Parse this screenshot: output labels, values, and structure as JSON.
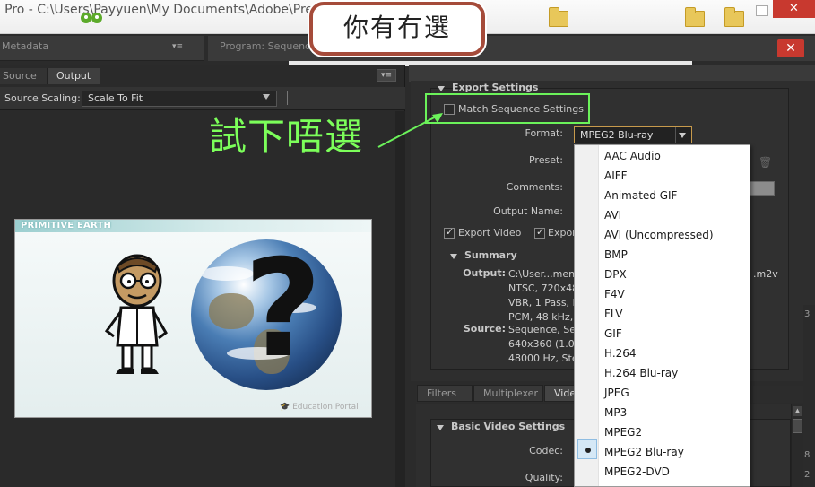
{
  "window": {
    "title": "e Pro - C:\\Users\\Payyuen\\My Documents\\Adobe\\Pre",
    "close_label": "✕"
  },
  "left_panel": {
    "metadata_tab": "Metadata",
    "tabs": [
      {
        "label": "Source"
      },
      {
        "label": "Output"
      }
    ],
    "menu_glyph": "▾≡",
    "source_scaling_label": "Source Scaling:",
    "source_scaling_value": "Scale To Fit"
  },
  "program_panel": {
    "title": "Program: Sequence",
    "close_label": "✕"
  },
  "video": {
    "banner_text": "PRIMITIVE EARTH",
    "question_mark": "?",
    "watermark": "Education Portal",
    "watermark_icon": "mortarboard-icon"
  },
  "export_settings": {
    "header": "Export Settings",
    "match_sequence_label": "Match Sequence Settings",
    "format_label": "Format:",
    "format_value": "MPEG2 Blu-ray",
    "preset_label": "Preset:",
    "comments_label": "Comments:",
    "output_name_label": "Output Name:",
    "export_video_label": "Export Video",
    "export_audio_label": "Expor",
    "summary_header": "Summary",
    "summary_output_label": "Output:",
    "summary_output_lines": [
      "C:\\User...ment",
      "NTSC, 720x480",
      "VBR, 1 Pass, M",
      "PCM, 48 kHz, 1"
    ],
    "summary_output_suffix": ".m2v",
    "summary_source_label": "Source:",
    "summary_source_lines": [
      "Sequence, Seq",
      "640x360 (1.0),",
      "48000 Hz, Ster"
    ]
  },
  "lower_tabs": [
    {
      "label": "Filters"
    },
    {
      "label": "Multiplexer"
    },
    {
      "label": "Vide"
    }
  ],
  "video_settings": {
    "header": "Basic Video Settings",
    "codec_label": "Codec:",
    "quality_label": "Quality:"
  },
  "format_dropdown": {
    "items": [
      "AAC Audio",
      "AIFF",
      "Animated GIF",
      "AVI",
      "AVI (Uncompressed)",
      "BMP",
      "DPX",
      "F4V",
      "FLV",
      "GIF",
      "H.264",
      "H.264 Blu-ray",
      "JPEG",
      "MP3",
      "MPEG2",
      "MPEG2 Blu-ray",
      "MPEG2-DVD"
    ],
    "selected": "MPEG2 Blu-ray"
  },
  "right_edge_digits": [
    "3",
    "8",
    "2"
  ],
  "annotations": {
    "callout_text": "你有冇選",
    "hint_text": "試下唔選",
    "highlight_color": "#6bf25a",
    "callout_border_color": "#a54b3a"
  }
}
